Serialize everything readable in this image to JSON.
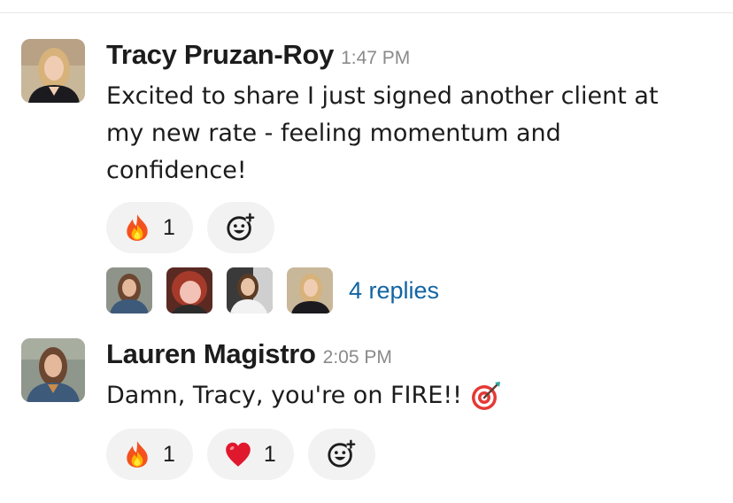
{
  "messages": [
    {
      "author": "Tracy Pruzan-Roy",
      "time": "1:47 PM",
      "text_lines": [
        "Excited to share I just signed another client at",
        "my new rate - feeling momentum and",
        "confidence!"
      ],
      "reactions": [
        {
          "emoji": "fire",
          "count": "1"
        }
      ],
      "thread": {
        "participant_count": 4,
        "replies_label": "4 replies"
      }
    },
    {
      "author": "Lauren Magistro",
      "time": "2:05 PM",
      "text": "Damn, Tracy, you're on FIRE!!",
      "inline_emoji": "direct-hit-target",
      "reactions": [
        {
          "emoji": "fire",
          "count": "1"
        },
        {
          "emoji": "red-heart",
          "count": "1"
        }
      ]
    }
  ],
  "colors": {
    "link": "#1264a3",
    "timestamp": "#8a8a8a",
    "reaction_bg": "#f2f2f2",
    "text": "#1d1c1d"
  }
}
